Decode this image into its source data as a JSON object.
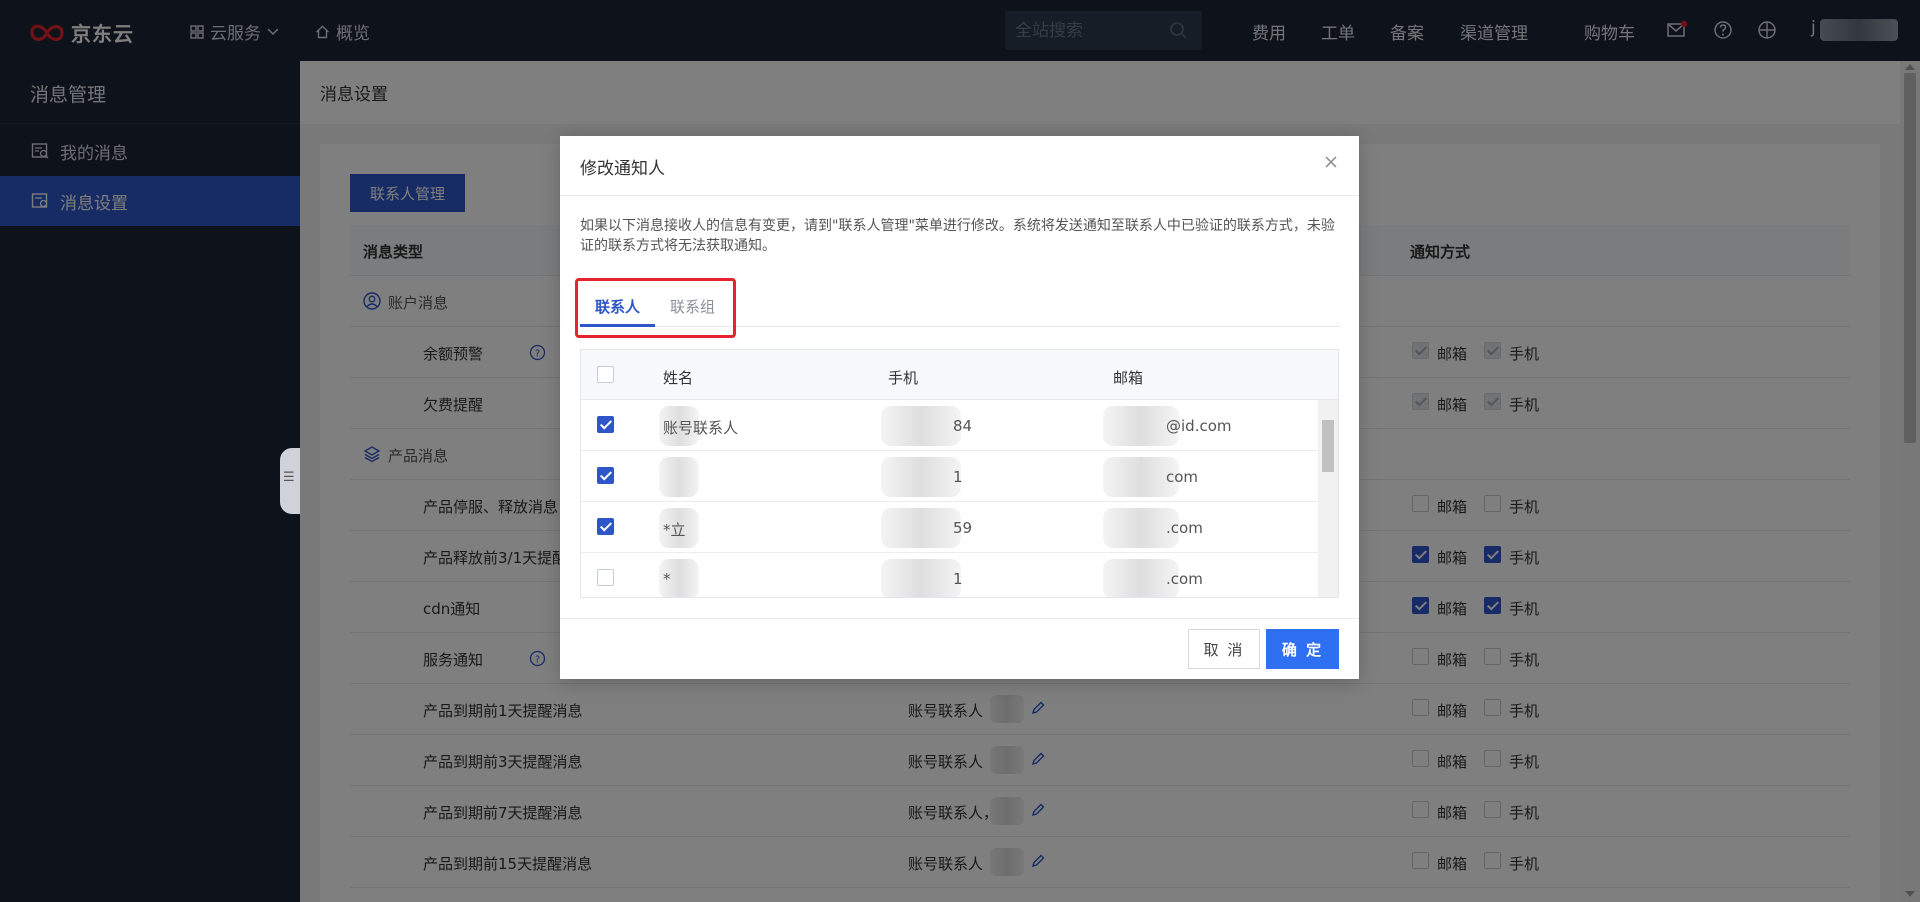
{
  "topbar": {
    "logo_text": "京东云",
    "nav": [
      {
        "label": "云服务",
        "icon": "grid-icon"
      },
      {
        "label": "概览",
        "icon": "home-icon"
      }
    ],
    "search": {
      "placeholder": "全站搜索"
    },
    "links": [
      "费用",
      "工单",
      "备案",
      "渠道管理",
      "购物车"
    ],
    "icons": [
      "mail-icon",
      "help-icon",
      "globe-icon"
    ],
    "user_initial": "j"
  },
  "sidebar": {
    "title": "消息管理",
    "items": [
      {
        "label": "我的消息",
        "icon": "message-icon",
        "active": false
      },
      {
        "label": "消息设置",
        "icon": "settings-message-icon",
        "active": true
      }
    ]
  },
  "main": {
    "header": "消息设置",
    "contacts_button": "联系人管理",
    "table": {
      "headers": {
        "type": "消息类型",
        "method": "通知方式"
      },
      "email_label": "邮箱",
      "phone_label": "手机",
      "rows": [
        {
          "kind": "group",
          "label": "账户消息",
          "icon": "user-circle-icon"
        },
        {
          "kind": "item",
          "label": "余额预警",
          "help": true,
          "email": true,
          "phone": true,
          "disabled": true,
          "contact": ""
        },
        {
          "kind": "item",
          "label": "欠费提醒",
          "help": false,
          "email": true,
          "phone": true,
          "disabled": true,
          "contact": ""
        },
        {
          "kind": "group",
          "label": "产品消息",
          "icon": "layers-icon"
        },
        {
          "kind": "item",
          "label": "产品停服、释放消息",
          "help": false,
          "email": false,
          "phone": false,
          "disabled": false,
          "contact": ""
        },
        {
          "kind": "item",
          "label": "产品释放前3/1天提醒",
          "help": false,
          "email": true,
          "phone": true,
          "disabled": false,
          "contact": ""
        },
        {
          "kind": "item",
          "label": "cdn通知",
          "help": false,
          "email": true,
          "phone": true,
          "disabled": false,
          "contact": ""
        },
        {
          "kind": "item",
          "label": "服务通知",
          "help": true,
          "email": false,
          "phone": false,
          "disabled": false,
          "contact": ""
        },
        {
          "kind": "item",
          "label": "产品到期前1天提醒消息",
          "help": false,
          "email": false,
          "phone": false,
          "disabled": false,
          "contact": "账号联系人"
        },
        {
          "kind": "item",
          "label": "产品到期前3天提醒消息",
          "help": false,
          "email": false,
          "phone": false,
          "disabled": false,
          "contact": "账号联系人"
        },
        {
          "kind": "item",
          "label": "产品到期前7天提醒消息",
          "help": false,
          "email": false,
          "phone": false,
          "disabled": false,
          "contact": "账号联系人，"
        },
        {
          "kind": "item",
          "label": "产品到期前15天提醒消息",
          "help": false,
          "email": false,
          "phone": false,
          "disabled": false,
          "contact": "账号联系人"
        }
      ]
    }
  },
  "modal": {
    "title": "修改通知人",
    "note": "如果以下消息接收人的信息有变更，请到\"联系人管理\"菜单进行修改。系统将发送通知至联系人中已验证的联系方式，未验证的联系方式将无法获取通知。",
    "tabs": [
      "联系人",
      "联系组"
    ],
    "columns": [
      "姓名",
      "手机",
      "邮箱"
    ],
    "rows": [
      {
        "checked": true,
        "name": "账号联系人",
        "phone": "84",
        "email": "@id.com"
      },
      {
        "checked": true,
        "name": "",
        "phone": "1",
        "email": "com"
      },
      {
        "checked": true,
        "name": "*立",
        "phone": "59",
        "email": ".com"
      },
      {
        "checked": false,
        "name": "*",
        "phone": "1",
        "email": ".com"
      }
    ],
    "cancel": "取 消",
    "confirm": "确 定"
  }
}
